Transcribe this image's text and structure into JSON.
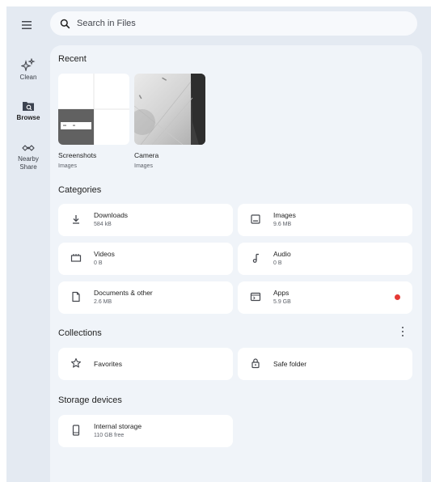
{
  "search": {
    "placeholder": "Search in Files"
  },
  "nav": {
    "items": [
      {
        "label": "Clean",
        "icon": "sparkle-icon"
      },
      {
        "label": "Browse",
        "icon": "browse-folder-icon",
        "active": true
      },
      {
        "label": "Nearby\nShare",
        "icon": "nearby-share-icon"
      }
    ]
  },
  "recent": {
    "title": "Recent",
    "items": [
      {
        "name": "Screenshots",
        "sub": "Images"
      },
      {
        "name": "Camera",
        "sub": "Images"
      }
    ]
  },
  "categories": {
    "title": "Categories",
    "items": [
      {
        "name": "Downloads",
        "size": "584 kB",
        "icon": "download-icon"
      },
      {
        "name": "Images",
        "size": "9.6 MB",
        "icon": "image-icon"
      },
      {
        "name": "Videos",
        "size": "0 B",
        "icon": "video-icon"
      },
      {
        "name": "Audio",
        "size": "0 B",
        "icon": "music-note-icon"
      },
      {
        "name": "Documents & other",
        "size": "2.6 MB",
        "icon": "document-icon"
      },
      {
        "name": "Apps",
        "size": "5.9 GB",
        "icon": "apps-icon",
        "badge_color": "#e53935"
      }
    ]
  },
  "collections": {
    "title": "Collections",
    "items": [
      {
        "name": "Favorites",
        "icon": "star-icon"
      },
      {
        "name": "Safe folder",
        "icon": "lock-icon"
      }
    ]
  },
  "storage": {
    "title": "Storage devices",
    "items": [
      {
        "name": "Internal storage",
        "sub": "110 GB free",
        "icon": "phone-icon"
      }
    ]
  },
  "colors": {
    "background": "#e4eaf2",
    "card": "#f0f4f9",
    "tile": "#ffffff",
    "badge": "#e53935"
  }
}
